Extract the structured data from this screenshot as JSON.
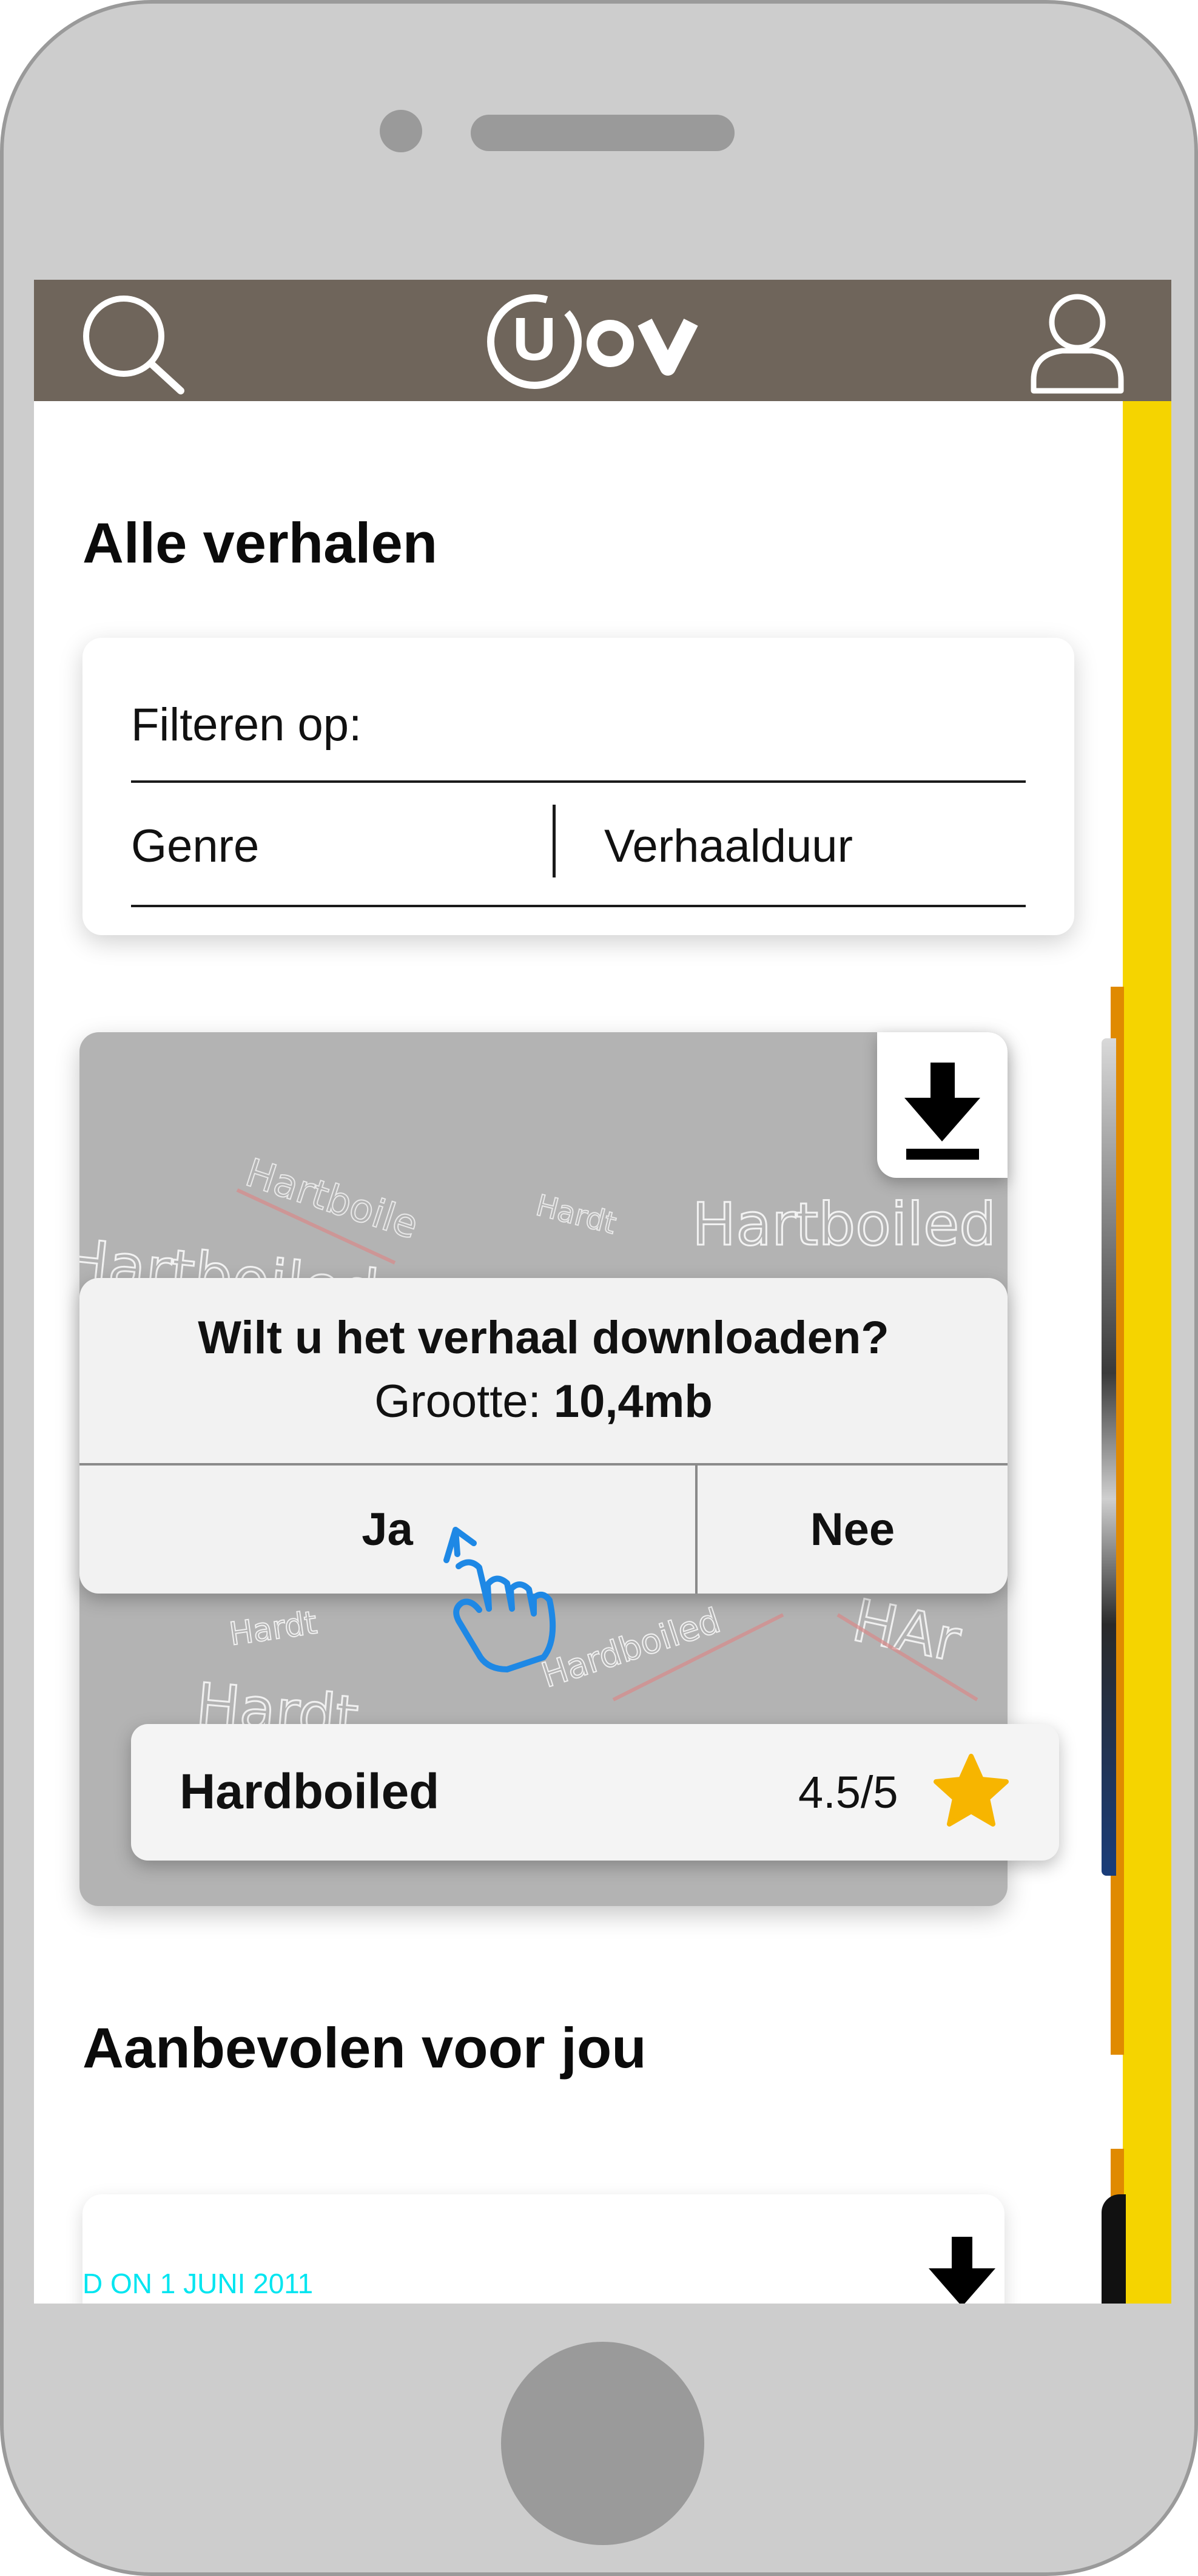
{
  "header": {
    "logo_text": "U OV"
  },
  "all_stories": {
    "title": "Alle verhalen",
    "filter": {
      "label": "Filteren op:",
      "options": [
        "Genre",
        "Verhaalduur"
      ]
    },
    "card": {
      "art_words": [
        "Hartboiled",
        "Hardboiled",
        "Hardt",
        "Hartboile",
        "HAr"
      ],
      "name": "Hardboiled",
      "rating": "4.5/5"
    }
  },
  "dialog": {
    "question": "Wilt u het verhaal downloaden?",
    "size_label": "Grootte:",
    "size_value": "10,4mb",
    "yes": "Ja",
    "no": "Nee"
  },
  "recommended": {
    "title": "Aanbevolen voor jou",
    "card_caption": "D ON 1 JUNI 2011"
  },
  "colors": {
    "header_bg": "#6f655b",
    "accent_yellow": "#f5d400",
    "accent_orange": "#e08a00",
    "star": "#f7b500",
    "pointer_blue": "#1e88e5"
  }
}
